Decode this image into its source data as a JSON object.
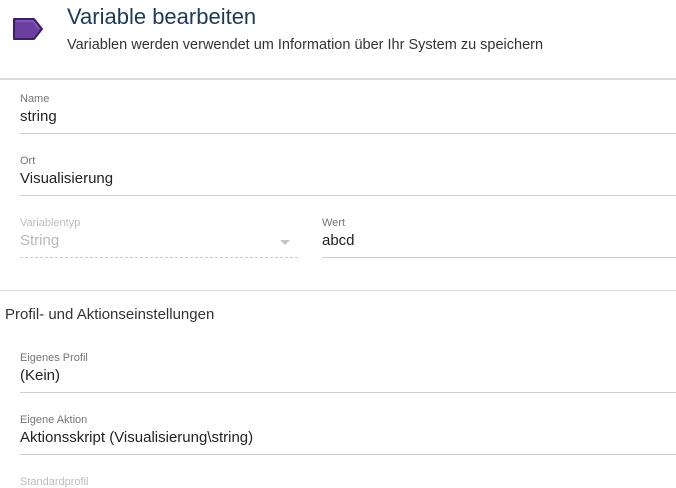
{
  "header": {
    "title": "Variable bearbeiten",
    "subtitle": "Variablen werden verwendet um Information über Ihr System zu speichern",
    "icon": "variable-tag-icon",
    "icon_color": "#6b3fa0"
  },
  "fields": {
    "name": {
      "label": "Name",
      "value": "string"
    },
    "ort": {
      "label": "Ort",
      "value": "Visualisierung"
    },
    "variablentyp": {
      "label": "Variablentyp",
      "value": "String"
    },
    "wert": {
      "label": "Wert",
      "value": "abcd"
    }
  },
  "profile_section": {
    "title": "Profil- und Aktionseinstellungen",
    "eigenes_profil": {
      "label": "Eigenes Profil",
      "value": "(Kein)"
    },
    "eigene_aktion": {
      "label": "Eigene Aktion",
      "value": "Aktionsskript (Visualisierung\\string)"
    },
    "standardprofil": {
      "label": "Standardprofil"
    }
  }
}
